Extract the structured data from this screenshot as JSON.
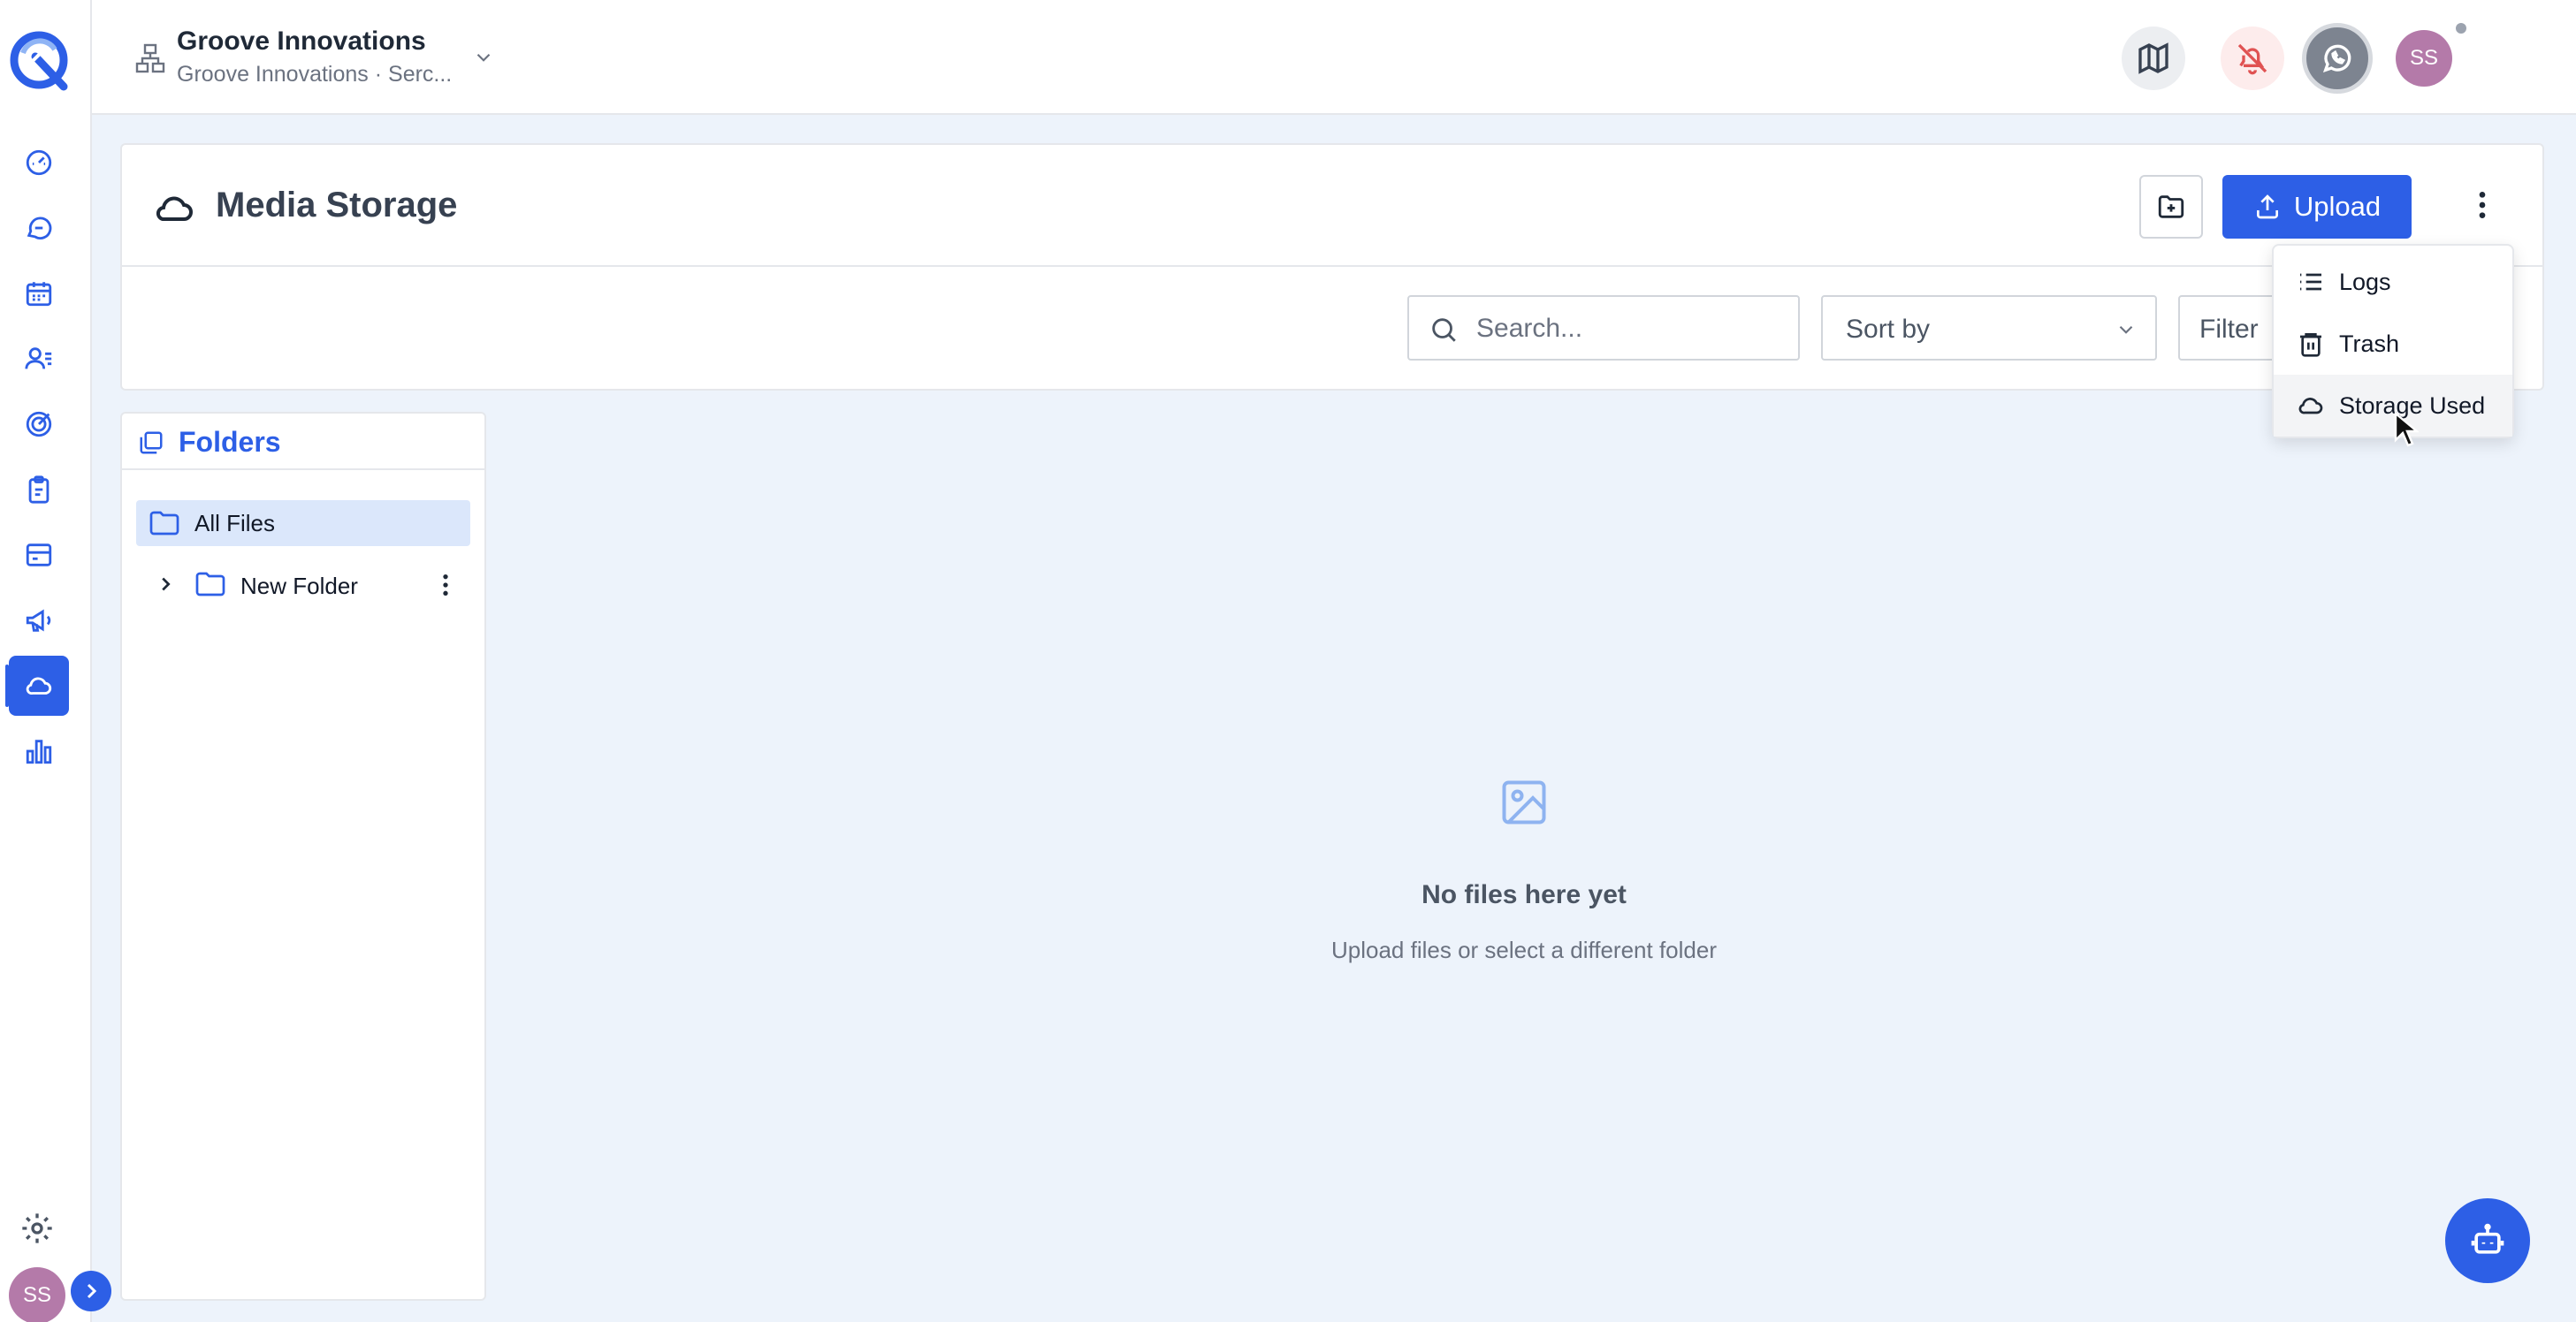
{
  "sidebar": {
    "items": [
      {
        "id": "dashboard",
        "icon": "speedometer-icon"
      },
      {
        "id": "conversations",
        "icon": "chat-bubble-icon"
      },
      {
        "id": "calendar",
        "icon": "calendar-icon"
      },
      {
        "id": "contacts",
        "icon": "contacts-icon"
      },
      {
        "id": "opportunities",
        "icon": "target-icon"
      },
      {
        "id": "forms",
        "icon": "clipboard-icon"
      },
      {
        "id": "payments",
        "icon": "credit-card-icon"
      },
      {
        "id": "marketing",
        "icon": "megaphone-icon"
      },
      {
        "id": "media-storage",
        "icon": "cloud-icon",
        "active": true
      },
      {
        "id": "reporting",
        "icon": "bar-chart-icon"
      }
    ],
    "settings_icon": "gear-icon",
    "avatar_initials": "SS",
    "expand_icon": "chevron-right-icon"
  },
  "topbar": {
    "org_name": "Groove Innovations",
    "org_subtitle": "Groove Innovations · Serc...",
    "avatar_initials": "SS"
  },
  "header": {
    "title": "Media Storage",
    "upload_label": "Upload"
  },
  "toolbar": {
    "search_placeholder": "Search...",
    "sort_label": "Sort by",
    "filter_label": "Filter"
  },
  "menu": {
    "items": [
      {
        "label": "Logs",
        "icon": "list-icon"
      },
      {
        "label": "Trash",
        "icon": "trash-icon"
      },
      {
        "label": "Storage Used",
        "icon": "cloud-icon",
        "hovered": true
      }
    ]
  },
  "folders": {
    "title": "Folders",
    "items": [
      {
        "label": "All Files",
        "selected": true
      },
      {
        "label": "New Folder",
        "collapsed": true
      }
    ]
  },
  "empty_state": {
    "title": "No files here yet",
    "subtitle": "Upload files or select a different folder"
  },
  "colors": {
    "primary": "#2d5fe6",
    "background": "#edf3fb",
    "avatar": "#b47aa9",
    "bell_alert": "#e05252"
  }
}
